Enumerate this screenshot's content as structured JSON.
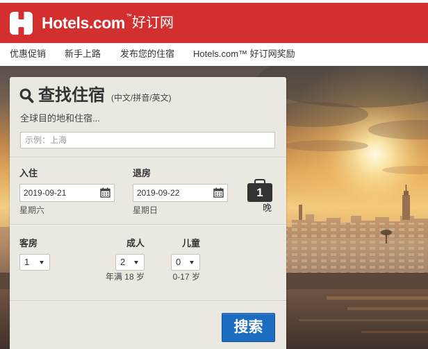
{
  "header": {
    "logo_text": "Hotels.com",
    "logo_tm": "™",
    "logo_cn": "好订网"
  },
  "nav": {
    "items": [
      "优惠促销",
      "新手上路",
      "发布您的住宿",
      "Hotels.com™ 好订网奖励"
    ]
  },
  "search": {
    "title": "查找住宿",
    "title_hint": "(中文/拼音/英文)",
    "destination": {
      "label": "全球目的地和住宿...",
      "placeholder": "示例：上海",
      "value": ""
    },
    "checkin": {
      "label": "入住",
      "value": "2019-09-21",
      "weekday": "星期六"
    },
    "checkout": {
      "label": "退房",
      "value": "2019-09-22",
      "weekday": "星期日"
    },
    "nights": {
      "count": "1",
      "label": "晚"
    },
    "rooms": {
      "label": "客房",
      "value": "1"
    },
    "adults": {
      "label": "成人",
      "value": "2",
      "hint": "年满 18 岁"
    },
    "children": {
      "label": "儿童",
      "value": "0",
      "hint": "0-17 岁"
    },
    "submit_label": "搜索"
  },
  "icons": {
    "logo": "hotels-logo-icon",
    "search": "search-icon",
    "calendar": "calendar-icon",
    "nights": "luggage-icon",
    "dropdown": "dropdown-arrow-icon"
  },
  "colors": {
    "brand_red": "#d32f2f",
    "button_blue": "#1c6cc1",
    "panel_bg": "#ebe8e2"
  }
}
